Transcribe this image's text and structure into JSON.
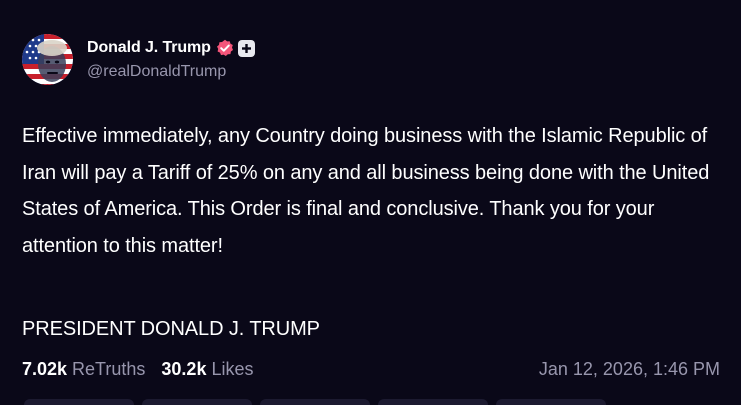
{
  "post": {
    "author": {
      "display_name": "Donald J. Trump",
      "handle": "@realDonaldTrump",
      "avatar_icon": "avatar-icon",
      "verified_icon": "verified-badge-icon",
      "plus_icon": "plus-icon",
      "verified_color": "#f4557a"
    },
    "body": "Effective immediately, any Country doing business with the Islamic Republic of Iran will pay a Tariff of 25% on any and all business being done with the United States of America. This Order is final and conclusive. Thank you for your attention to this matter!",
    "signature": "PRESIDENT DONALD J. TRUMP",
    "stats": {
      "retruths_count": "7.02k",
      "retruths_label": "ReTruths",
      "likes_count": "30.2k",
      "likes_label": "Likes"
    },
    "timestamp": "Jan 12, 2026, 1:46 PM"
  },
  "theme": {
    "background": "#0a0818",
    "text": "#ffffff",
    "muted": "#9896ad"
  }
}
